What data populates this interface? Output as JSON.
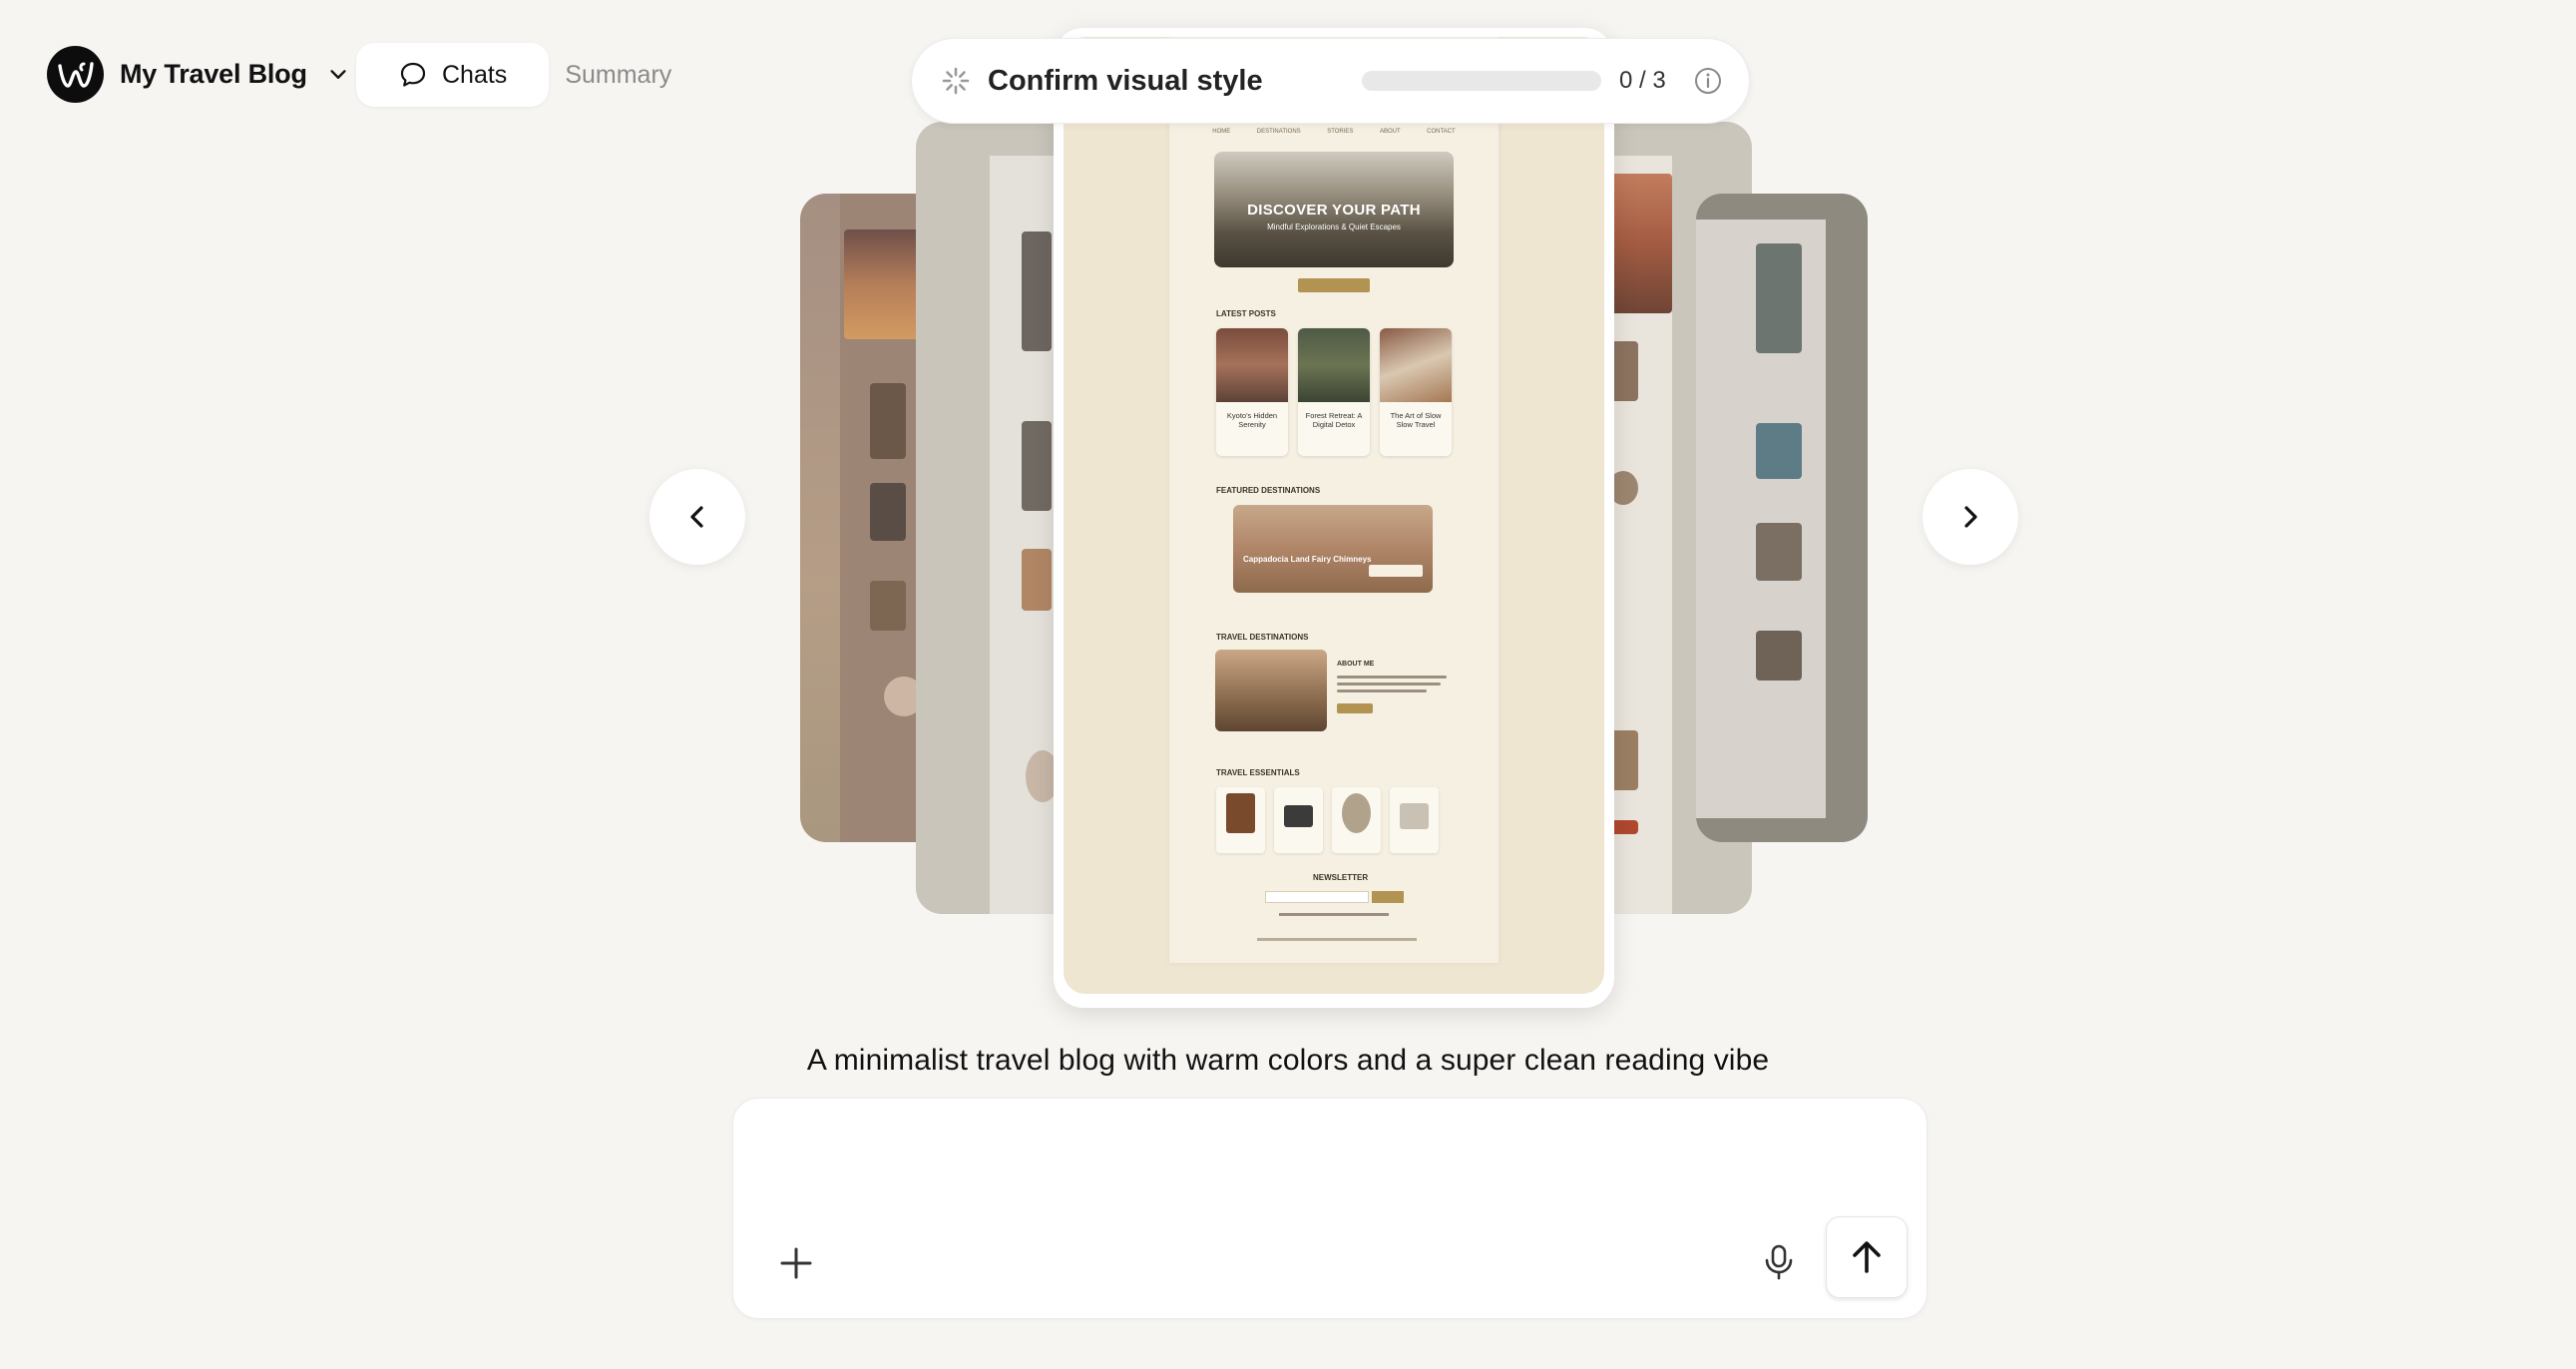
{
  "header": {
    "project_name": "My Travel Blog",
    "tabs": [
      {
        "label": "Chats",
        "icon": "chat-bubble-icon",
        "active": true
      },
      {
        "label": "Summary",
        "active": false
      }
    ]
  },
  "progress": {
    "title": "Confirm visual style",
    "count": "0 / 3",
    "fraction": 0,
    "icon": "loading-spinner-icon"
  },
  "carousel": {
    "preview": {
      "nav": [
        "HOME",
        "DESTINATIONS",
        "STORIES",
        "ABOUT",
        "CONTACT"
      ],
      "hero_title": "DISCOVER YOUR PATH",
      "hero_subtitle": "Mindful Explorations & Quiet Escapes",
      "latest_posts_heading": "LATEST POSTS",
      "posts": [
        {
          "title": "Kyoto's Hidden Serenity"
        },
        {
          "title": "Forest Retreat: A Digital Detox"
        },
        {
          "title": "The Art of Slow Slow Travel"
        }
      ],
      "featured_heading": "FEATURED DESTINATIONS",
      "featured_title": "Cappadocia Land Fairy Chimneys",
      "travel_destinations_heading": "TRAVEL DESTINATIONS",
      "about_heading": "ABOUT ME",
      "essentials_heading": "TRAVEL ESSENTIALS",
      "newsletter_heading": "NEWSLETTER"
    }
  },
  "caption": "A minimalist travel blog with warm colors and a super clean reading vibe",
  "composer": {
    "placeholder": ""
  },
  "colors": {
    "background": "#f6f5f2",
    "accent_gold": "#b39352",
    "logo": "#0d0d0d"
  }
}
